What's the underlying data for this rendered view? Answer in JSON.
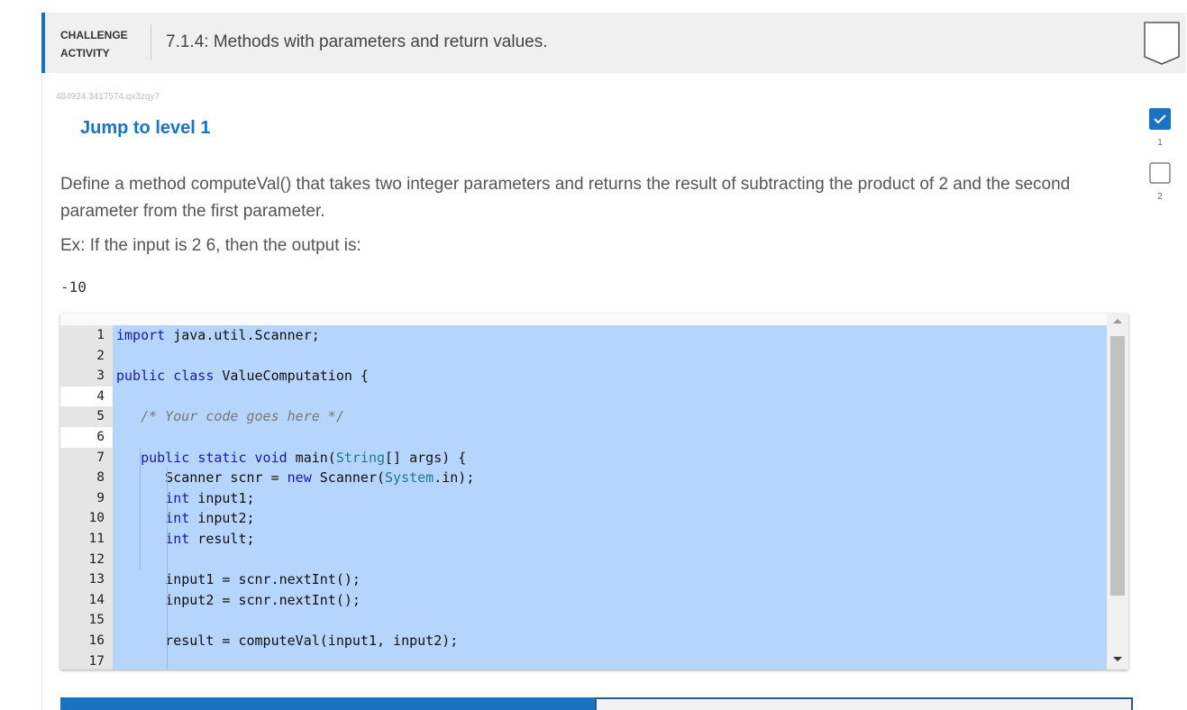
{
  "header": {
    "tag_line1": "CHALLENGE",
    "tag_line2": "ACTIVITY",
    "title": "7.1.4: Methods with parameters and return values."
  },
  "activity_id": "484924.3417574.qx3zqy7",
  "jump_link": "Jump to level 1",
  "levels": [
    {
      "label": "1",
      "completed": true
    },
    {
      "label": "2",
      "completed": false
    }
  ],
  "prompt": "Define a method computeVal() that takes two integer parameters and returns the result of subtracting the product of 2 and the second parameter from the first parameter.",
  "example_text": "Ex: If the input is 2 6, then the output is:",
  "example_output": "-10",
  "code": {
    "line_numbers": [
      "1",
      "2",
      "3",
      "4",
      "5",
      "6",
      "7",
      "8",
      "9",
      "10",
      "11",
      "12",
      "13",
      "14",
      "15",
      "16",
      "17"
    ],
    "lines": [
      "import java.util.Scanner;",
      "",
      "public class ValueComputation {",
      "",
      "   /* Your code goes here */",
      "",
      "   public static void main(String[] args) {",
      "      Scanner scnr = new Scanner(System.in);",
      "      int input1;",
      "      int input2;",
      "      int result;",
      "",
      "      input1 = scnr.nextInt();",
      "      input2 = scnr.nextInt();",
      "",
      "      result = computeVal(input1, input2);",
      ""
    ]
  },
  "colors": {
    "accent": "#1a73c0",
    "selection": "#b5d5fc",
    "level_done": "#1a73c0"
  }
}
